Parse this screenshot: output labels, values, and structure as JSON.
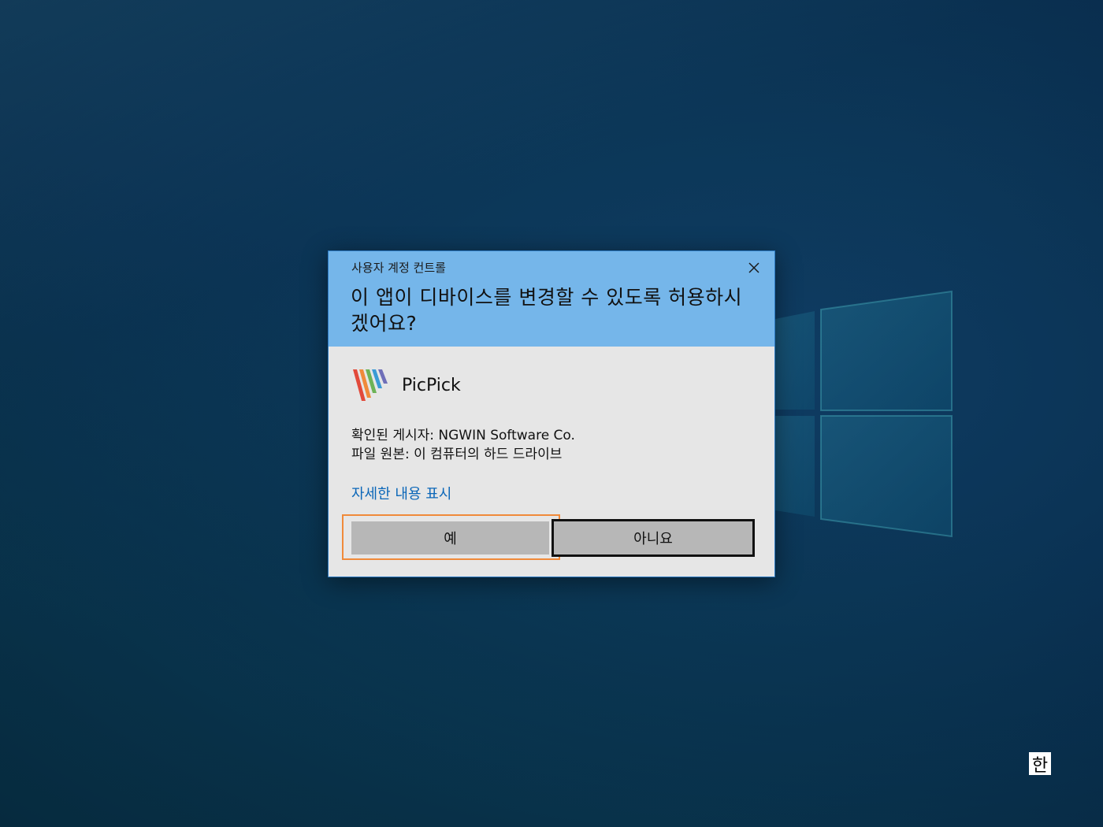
{
  "dialog": {
    "caption": "사용자 계정 컨트롤",
    "question": "이 앱이 디바이스를 변경할 수 있도록 허용하시겠어요?",
    "app_name": "PicPick",
    "publisher": "확인된 게시자: NGWIN Software Co.",
    "origin": "파일 원본: 이 컴퓨터의 하드 드라이브",
    "details_link": "자세한 내용 표시",
    "yes_label": "예",
    "no_label": "아니요"
  },
  "taskbar": {
    "ime_indicator": "한"
  },
  "colors": {
    "header_blue": "#75b6ea",
    "dialog_body": "#e6e6e6",
    "button_gray": "#b7b7b7",
    "link_blue": "#0a66b8",
    "focus_orange": "#f08a3a",
    "desktop_blue": "#0b3456"
  },
  "icons": {
    "close": "close-icon",
    "app": "picpick-app-icon"
  }
}
